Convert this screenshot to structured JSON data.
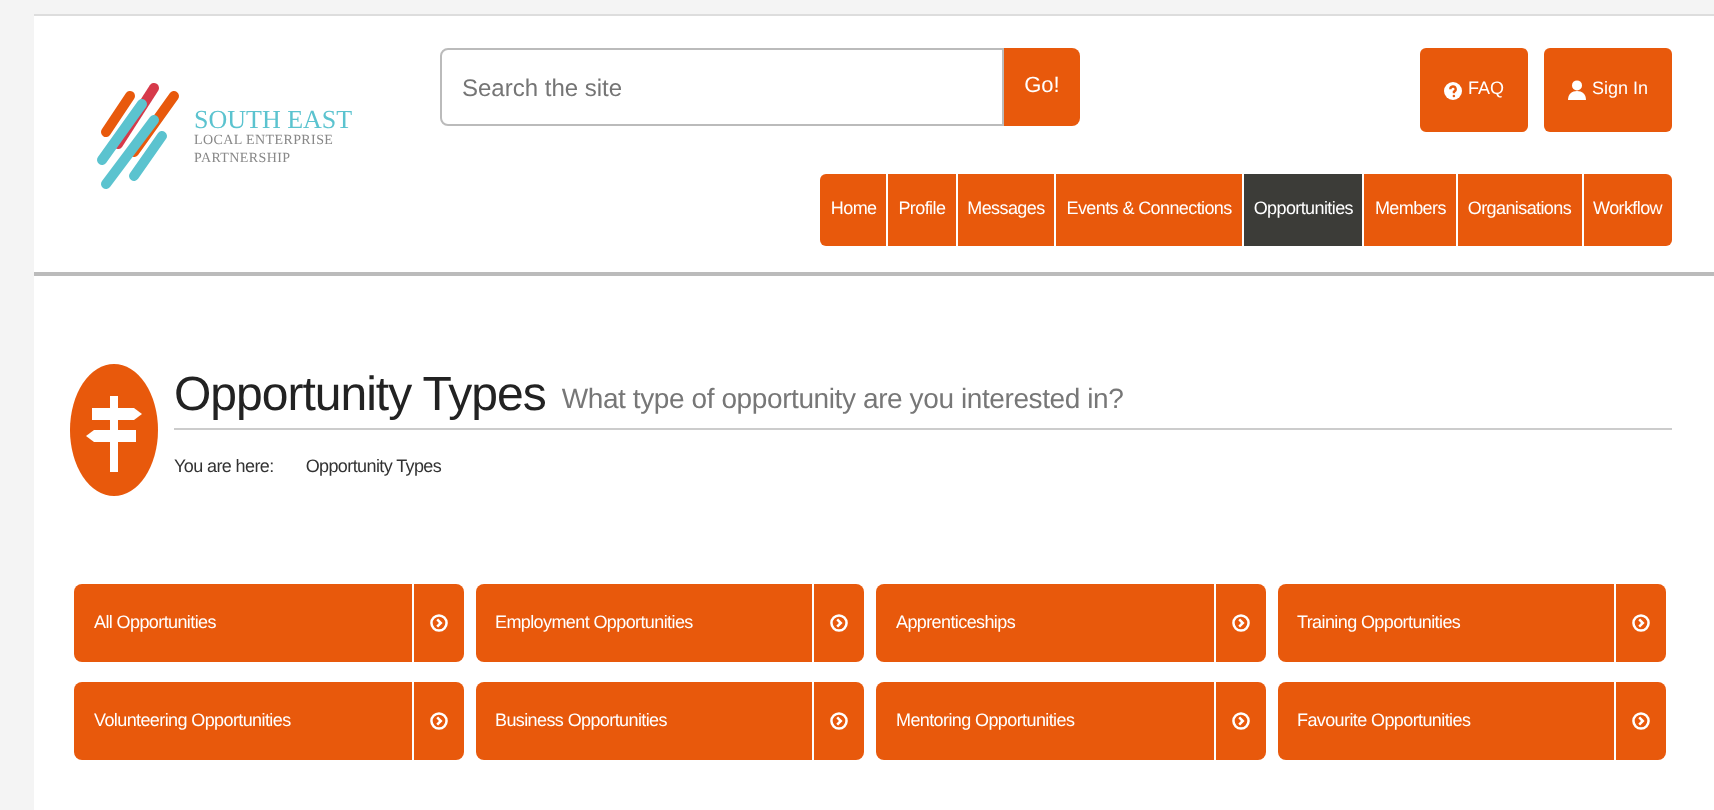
{
  "logo": {
    "name": "SOUTH EAST",
    "line_2": "LOCAL ENTERPRISE",
    "line_3": "PARTNERSHIP"
  },
  "search": {
    "placeholder": "Search the site",
    "button": "Go!"
  },
  "header_buttons": [
    {
      "kind": "faq",
      "label": "FAQ"
    },
    {
      "kind": "user",
      "label": "Sign In"
    }
  ],
  "nav": [
    {
      "label": "Home",
      "selected": false
    },
    {
      "label": "Profile",
      "selected": false
    },
    {
      "label": "Messages",
      "selected": false
    },
    {
      "label": "Events & Connections",
      "selected": false
    },
    {
      "label": "Opportunities",
      "selected": true
    },
    {
      "label": "Members",
      "selected": false
    },
    {
      "label": "Organisations",
      "selected": false
    },
    {
      "label": "Workflow",
      "selected": false
    }
  ],
  "page": {
    "title": "Opportunity Types",
    "subtitle": "What type of opportunity are you interested in?"
  },
  "breadcrumb": {
    "label": "You are here:",
    "items": [
      "Opportunity Types"
    ]
  },
  "tiles": [
    "All Opportunities",
    "Employment Opportunities",
    "Apprenticeships",
    "Training Opportunities",
    "Volunteering Opportunities",
    "Business Opportunities",
    "Mentoring Opportunities",
    "Favourite Opportunities"
  ]
}
